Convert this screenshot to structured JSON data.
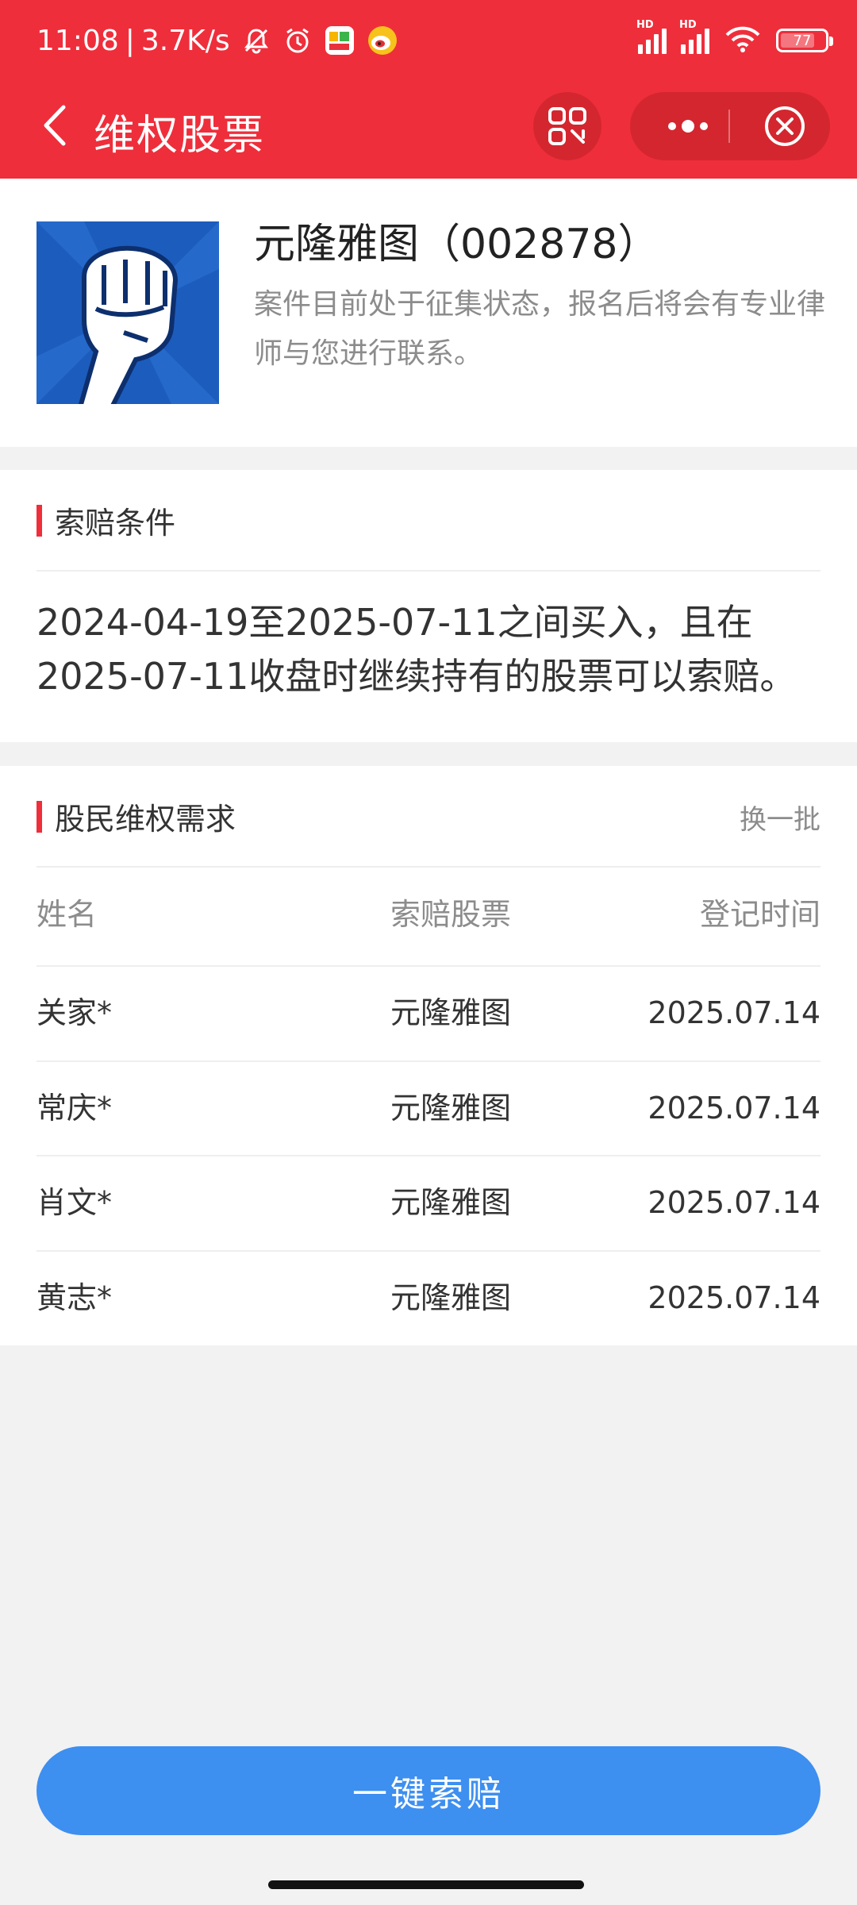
{
  "status_bar": {
    "time": "11:08",
    "net_speed": "3.7K/s",
    "battery": "77",
    "battery_fraction": 0.77,
    "icons": [
      "mute-bell-icon",
      "alarm-icon",
      "app-58-icon",
      "weibo-icon",
      "signal-hd-icon",
      "signal-hd-icon",
      "wifi-icon",
      "battery-icon"
    ]
  },
  "nav": {
    "title": "维权股票",
    "back_icon": "chevron-left-icon",
    "qr_icon": "qr-scan-icon",
    "more_icon": "more-dots-icon",
    "close_icon": "close-circle-icon"
  },
  "stock": {
    "name": "元隆雅图（002878）",
    "description": "案件目前处于征集状态，报名后将会有专业律师与您进行联系。",
    "logo_icon": "raised-fist-icon"
  },
  "conditions": {
    "heading": "索赔条件",
    "text": "2024-04-19至2025-07-11之间买入，且在2025-07-11收盘时继续持有的股票可以索赔。"
  },
  "requests": {
    "heading": "股民维权需求",
    "refresh_label": "换一批",
    "columns": [
      "姓名",
      "索赔股票",
      "登记时间"
    ],
    "rows": [
      [
        "关家*",
        "元隆雅图",
        "2025.07.14"
      ],
      [
        "常庆*",
        "元隆雅图",
        "2025.07.14"
      ],
      [
        "肖文*",
        "元隆雅图",
        "2025.07.14"
      ],
      [
        "黄志*",
        "元隆雅图",
        "2025.07.14"
      ]
    ]
  },
  "cta": {
    "label": "一键索赔"
  },
  "colors": {
    "brand_red": "#ef2e3b",
    "button_blue": "#3d8ff0",
    "muted_text": "#8c8c8c"
  }
}
